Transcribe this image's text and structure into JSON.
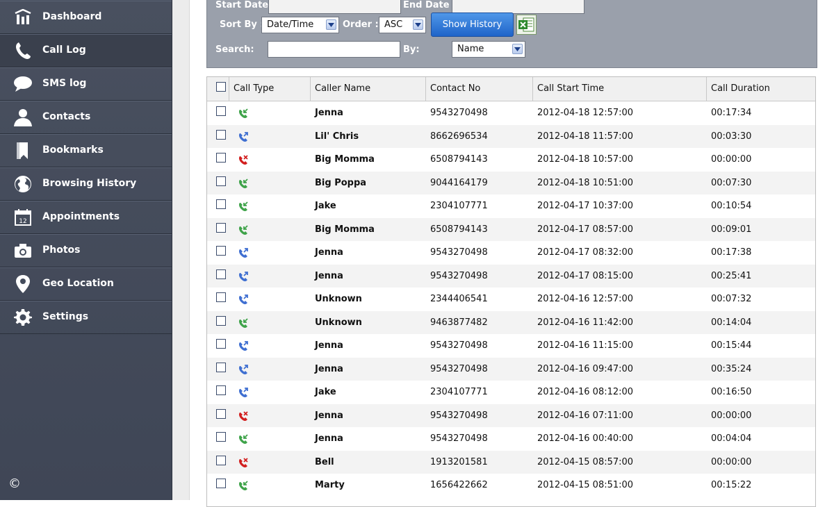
{
  "sidebar": {
    "items": [
      {
        "label": "Dashboard",
        "icon": "dashboard-icon"
      },
      {
        "label": "Call Log",
        "icon": "phone-icon",
        "active": true
      },
      {
        "label": "SMS log",
        "icon": "chat-bubble-icon"
      },
      {
        "label": "Contacts",
        "icon": "person-icon"
      },
      {
        "label": "Bookmarks",
        "icon": "bookmark-icon"
      },
      {
        "label": "Browsing History",
        "icon": "globe-icon"
      },
      {
        "label": "Appointments",
        "icon": "calendar-icon"
      },
      {
        "label": "Photos",
        "icon": "camera-icon"
      },
      {
        "label": "Geo Location",
        "icon": "map-pin-icon"
      },
      {
        "label": "Settings",
        "icon": "gear-icon"
      }
    ],
    "copyright": "©"
  },
  "filter": {
    "start_date_label": "Start Date :",
    "start_date_value": "",
    "end_date_label": "End Date :",
    "end_date_value": "",
    "sort_by_label": "Sort By :",
    "sort_by_value": "Date/Time",
    "order_label": "Order :",
    "order_value": "ASC",
    "show_history_label": "Show History",
    "search_label": "Search:",
    "search_value": "",
    "by_label": "By:",
    "by_value": "Name"
  },
  "table": {
    "headers": [
      "Call Type",
      "Caller Name",
      "Contact No",
      "Call Start Time",
      "Call Duration"
    ],
    "rows": [
      {
        "type": "incoming",
        "name": "Jenna",
        "number": "9543270498",
        "start": "2012-04-18 12:57:00",
        "duration": "00:17:34"
      },
      {
        "type": "outgoing",
        "name": "Lil' Chris",
        "number": "8662696534",
        "start": "2012-04-18 11:57:00",
        "duration": "00:03:30"
      },
      {
        "type": "missed",
        "name": "Big Momma",
        "number": "6508794143",
        "start": "2012-04-18 10:57:00",
        "duration": "00:00:00"
      },
      {
        "type": "incoming",
        "name": "Big Poppa",
        "number": "9044164179",
        "start": "2012-04-18 10:51:00",
        "duration": "00:07:30"
      },
      {
        "type": "incoming",
        "name": "Jake",
        "number": "2304107771",
        "start": "2012-04-17 10:37:00",
        "duration": "00:10:54"
      },
      {
        "type": "incoming",
        "name": "Big Momma",
        "number": "6508794143",
        "start": "2012-04-17 08:57:00",
        "duration": "00:09:01"
      },
      {
        "type": "outgoing",
        "name": "Jenna",
        "number": "9543270498",
        "start": "2012-04-17 08:32:00",
        "duration": "00:17:38"
      },
      {
        "type": "outgoing",
        "name": "Jenna",
        "number": "9543270498",
        "start": "2012-04-17 08:15:00",
        "duration": "00:25:41"
      },
      {
        "type": "outgoing",
        "name": "Unknown",
        "number": "2344406541",
        "start": "2012-04-16 12:57:00",
        "duration": "00:07:32"
      },
      {
        "type": "incoming",
        "name": "Unknown",
        "number": "9463877482",
        "start": "2012-04-16 11:42:00",
        "duration": "00:14:04"
      },
      {
        "type": "outgoing",
        "name": "Jenna",
        "number": "9543270498",
        "start": "2012-04-16 11:15:00",
        "duration": "00:15:44"
      },
      {
        "type": "outgoing",
        "name": "Jenna",
        "number": "9543270498",
        "start": "2012-04-16 09:47:00",
        "duration": "00:35:24"
      },
      {
        "type": "outgoing",
        "name": "Jake",
        "number": "2304107771",
        "start": "2012-04-16 08:12:00",
        "duration": "00:16:50"
      },
      {
        "type": "missed",
        "name": "Jenna",
        "number": "9543270498",
        "start": "2012-04-16 07:11:00",
        "duration": "00:00:00"
      },
      {
        "type": "incoming",
        "name": "Jenna",
        "number": "9543270498",
        "start": "2012-04-16 00:40:00",
        "duration": "00:04:04"
      },
      {
        "type": "missed",
        "name": "Bell",
        "number": "1913201581",
        "start": "2012-04-15 08:57:00",
        "duration": "00:00:00"
      },
      {
        "type": "incoming",
        "name": "Marty",
        "number": "1656422662",
        "start": "2012-04-15 08:51:00",
        "duration": "00:15:22"
      }
    ]
  },
  "colors": {
    "sidebar_bg": "#444c5c",
    "filter_bg": "#9aa0ab",
    "button_blue": "#2f78d8",
    "incoming": "#3fa34a",
    "outgoing": "#3f6fd1",
    "missed": "#d21f1f"
  }
}
